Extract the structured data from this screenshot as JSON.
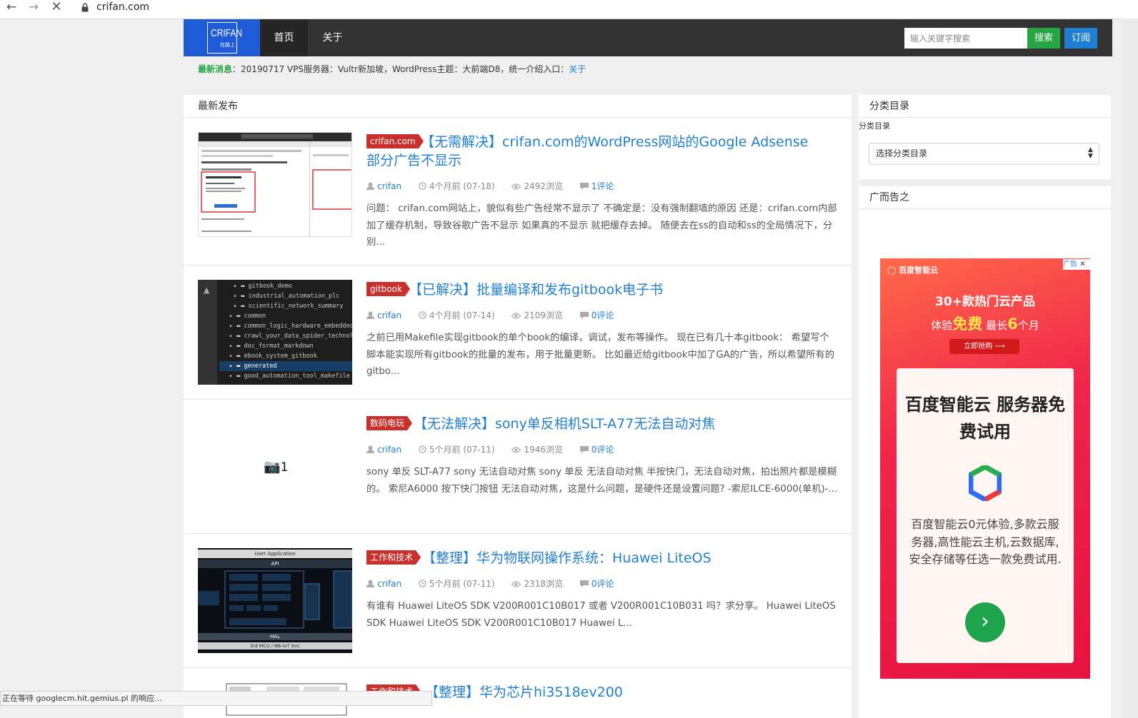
{
  "browser": {
    "back_icon": "arrow-left",
    "forward_icon": "arrow-right",
    "stop_icon": "close",
    "url": "crifan.com",
    "status": "正在等待 googlecm.hit.gemius.pl 的响应..."
  },
  "header": {
    "logo_text": "CRIFAN",
    "logo_sub": "在路上",
    "nav": [
      "首页",
      "关于"
    ],
    "search_placeholder": "输入关键字搜索",
    "search_button": "搜索",
    "subscribe_button": "订阅",
    "colors": {
      "bar": "#333333",
      "logo_bg": "#1e5bd8",
      "search": "#25a543",
      "subscribe": "#1f7fd0"
    }
  },
  "news": {
    "label": "最新消息",
    "text": "：20190717 VPS服务器：Vultr新加坡，WordPress主题：大前端D8，统一介绍入口：",
    "link": "关于"
  },
  "main": {
    "title": "最新发布",
    "posts": [
      {
        "tag": "crifan.com",
        "title_line1": "【无需解决】crifan.com的WordPress网站的Google Adsense",
        "title_line2": "部分广告不显示",
        "author": "crifan",
        "time": "4个月前 (07-18)",
        "views": "2492浏览",
        "comments": "1评论",
        "excerpt": "问题： crifan.com网站上，貌似有些广告经常不显示了 不确定是：没有强制翻墙的原因 还是：crifan.com内部加了缓存机制，导致谷歌广告不显示 如果真的不显示 就把缓存去掉。 随便去在ss的自动和ss的全局情况下，分别..."
      },
      {
        "tag": "gitbook",
        "title_line1": "【已解决】批量编译和发布gitbook电子书",
        "author": "crifan",
        "time": "4个月前 (07-14)",
        "views": "2109浏览",
        "comments": "0评论",
        "excerpt": "之前已用Makefile实现gitbook的单个book的编译，调试，发布等操作。 现在已有几十本gitbook： 希望写个脚本能实现所有gitbook的批量的发布，用于批量更新。 比如最近给gitbook中加了GA的广告，所以希望所有的gitbo...",
        "thumb_items": [
          "gitbook_demo",
          "industrial_automation_plc",
          "scientific_network_summary",
          "common",
          "common_logic_hardware_embedded",
          "crawl_your_data_spider_technology",
          "doc_format_markdown",
          "ebook_system_gitbook",
          "generated",
          "good_automation_tool_makefile"
        ]
      },
      {
        "tag": "数码电玩",
        "title_line1": "【无法解决】sony单反相机SLT-A77无法自动对焦",
        "author": "crifan",
        "time": "5个月前 (07-11)",
        "views": "1946浏览",
        "comments": "0评论",
        "excerpt": "sony 单反 SLT-A77 sony 无法自动对焦 sony 单反 无法自动对焦 半按快门，无法自动对焦，拍出照片都是模糊的。 索尼A6000 按下快门按钮 无法自动对焦，这是什么问题，是硬件还是设置问题? -索尼ILCE-6000(单机)-...",
        "thumb_count": "1"
      },
      {
        "tag": "工作和技术",
        "title_line1": "【整理】华为物联网操作系统：Huawei LiteOS",
        "author": "crifan",
        "time": "5个月前 (07-11)",
        "views": "2318浏览",
        "comments": "0评论",
        "excerpt": "有谁有 Huawei LiteOS SDK V200R001C10B017 或者 V200R001C10B031 吗？求分享。 Huawei LiteOS SDK Huawei LiteOS SDK V200R001C10B017 Huawei L...",
        "thumb_top": "User Application",
        "thumb_api": "API",
        "thumb_hal": "HAL",
        "thumb_bottom": "3rd MCU / NB-IoT SoC"
      },
      {
        "tag": "工作和技术",
        "title_line1": "【整理】华为芯片hi3518ev200"
      }
    ]
  },
  "sidebar": {
    "category_title": "分类目录",
    "category_label": "分类目录",
    "category_select": "选择分类目录",
    "ad_section_title": "广而告之"
  },
  "ad": {
    "brand": "百度智能云",
    "badge": "广告",
    "headline1": "30+款热门云产品",
    "headline2_pre": "体验",
    "headline2_free": "免费",
    "headline2_mid": "最长",
    "headline2_num": "6",
    "headline2_post": "个月",
    "cta": "立即抢购",
    "title": "百度智能云 服务器免费试用",
    "desc": "百度智能云0元体验,多款云服务器,高性能云主机,云数据库,安全存储等任选一款免费试用."
  }
}
